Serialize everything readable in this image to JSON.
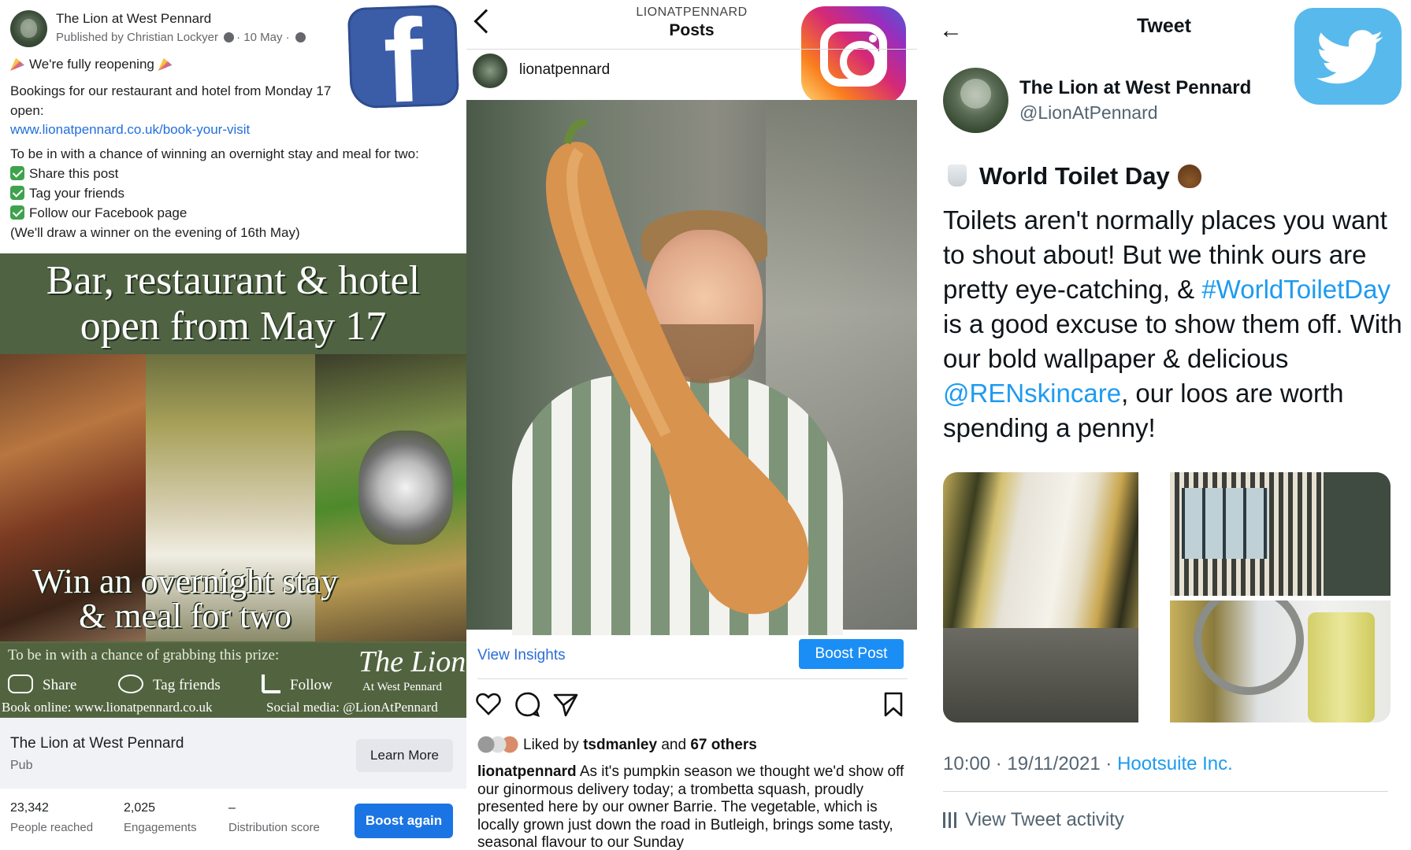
{
  "facebook": {
    "page_name": "The Lion at West Pennard",
    "published_by": "Published by Christian Lockyer",
    "date": "10 May",
    "line1": "We're fully reopening",
    "line2": "Bookings for our restaurant and hotel from Monday 17",
    "line3": "open:",
    "link": "www.lionatpennard.co.uk/book-your-visit",
    "line4": "To be in with a chance of winning an overnight stay and meal for two:",
    "steps": [
      "Share this post",
      "Tag your friends",
      "Follow our Facebook page"
    ],
    "line5": "(We'll draw a winner on the evening of 16th May)",
    "banner": {
      "headline_1": "Bar, restaurant & hotel",
      "headline_2": "open from May 17",
      "win_1": "Win an overnight stay",
      "win_2": "& meal for two",
      "prize_line": "To be in with a chance of grabbing this prize:",
      "actions": [
        "Share",
        "Tag friends",
        "Follow"
      ],
      "brand": "The Lion",
      "brand_sub": "At West Pennard",
      "book_online": "Book online: www.lionatpennard.co.uk",
      "social": "Social media: @LionAtPennard"
    },
    "card_name": "The Lion at West Pennard",
    "card_category": "Pub",
    "learn_more": "Learn More",
    "stats": [
      {
        "value": "23,342",
        "label": "People reached"
      },
      {
        "value": "2,025",
        "label": "Engagements"
      },
      {
        "value": "–",
        "label": "Distribution score"
      }
    ],
    "boost_again": "Boost again",
    "logo_letter": "f",
    "brand_color": "#3b5da8"
  },
  "instagram": {
    "top_user": "LIONATPENNARD",
    "title": "Posts",
    "handle": "lionatpennard",
    "view_insights": "View Insights",
    "boost_post": "Boost Post",
    "liked_prefix": "Liked by",
    "liked_user": "tsdmanley",
    "liked_and": "and",
    "liked_others": "67 others",
    "caption_user": "lionatpennard",
    "caption_text": "As it's pumpkin season we thought we'd show off our ginormous delivery today; a trombetta squash, proudly presented here by our owner Barrie. The vegetable, which is locally grown just down the road in Butleigh, brings some tasty, seasonal flavour to our Sunday",
    "icons": [
      "heart-icon",
      "comment-icon",
      "share-icon",
      "bookmark-icon"
    ],
    "accent_color": "#1b8ef5"
  },
  "twitter": {
    "title": "Tweet",
    "name": "The Lion at West Pennard",
    "handle": "@LionAtPennard",
    "heading": "World Toilet Day",
    "body_1": "Toilets aren't normally places you want to shout about! But we think ours are pretty eye-catching, & ",
    "hashtag": "#WorldToiletDay",
    "body_2": " is a good excuse to show them off. With our bold wallpaper & delicious ",
    "mention": "@RENskincare",
    "body_3": ", our loos are worth spending a penny!",
    "timestamp": "10:00 · 19/11/2021 · ",
    "source": "Hootsuite Inc.",
    "activity": "View Tweet activity",
    "link_color": "#1d9bf0"
  }
}
